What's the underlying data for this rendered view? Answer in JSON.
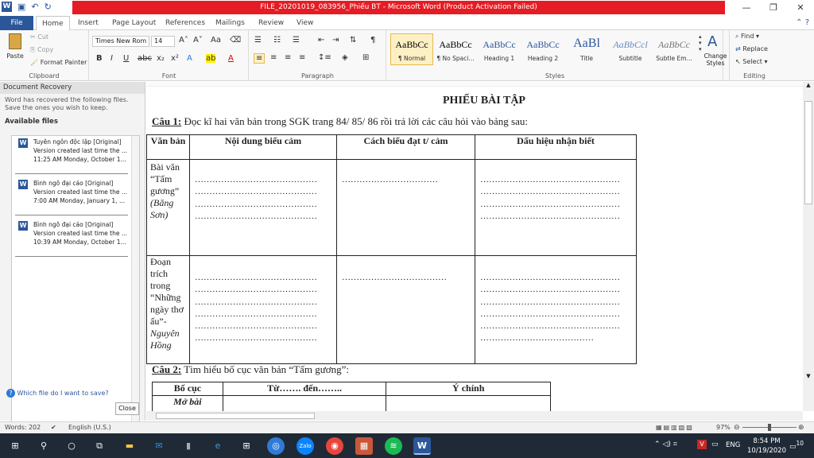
{
  "window": {
    "title": "FILE_20201019_083956_Phiếu BT - Microsoft Word (Product Activation Failed)"
  },
  "tabs": [
    "File",
    "Home",
    "Insert",
    "Page Layout",
    "References",
    "Mailings",
    "Review",
    "View"
  ],
  "clipboard": {
    "paste": "Paste",
    "cut": "Cut",
    "copy": "Copy",
    "painter": "Format Painter",
    "label": "Clipboard"
  },
  "font": {
    "name": "Times New Rom",
    "size": "14",
    "label": "Font"
  },
  "paragraph": {
    "label": "Paragraph"
  },
  "styles": {
    "label": "Styles",
    "items": [
      {
        "sample": "AaBbCc",
        "name": "¶ Normal"
      },
      {
        "sample": "AaBbCc",
        "name": "¶ No Spaci..."
      },
      {
        "sample": "AaBbCc",
        "name": "Heading 1"
      },
      {
        "sample": "AaBbCc",
        "name": "Heading 2"
      },
      {
        "sample": "AaBl",
        "name": "Title"
      },
      {
        "sample": "AaBbCcl",
        "name": "Subtitle"
      },
      {
        "sample": "AaBbCc",
        "name": "Subtle Em..."
      }
    ],
    "change": "Change Styles"
  },
  "editing": {
    "find": "Find",
    "replace": "Replace",
    "select": "Select",
    "label": "Editing"
  },
  "recovery": {
    "header": "Document Recovery",
    "desc": "Word has recovered the following files. Save the ones you wish to keep.",
    "available": "Available files",
    "files": [
      {
        "name": "Tuyên ngôn độc lập  [Original]",
        "l2": "Version created last time the ...",
        "l3": "11:25 AM Monday, October 1..."
      },
      {
        "name": "Bình ngô đại cáo  [Original]",
        "l2": "Version created last time the ...",
        "l3": "7:00 AM Monday, January 1, ..."
      },
      {
        "name": "Bình ngô đại cáo  [Original]",
        "l2": "Version created last time the ...",
        "l3": "10:39 AM Monday, October 1..."
      }
    ],
    "help": "Which file do I want to save?",
    "close": "Close"
  },
  "doc": {
    "title": "PHIẾU BÀI TẬP",
    "q1_label": "Câu 1:",
    "q1_text": " Đọc kĩ hai văn bản trong SGK trang 84/ 85/ 86 rồi trả lời các câu hỏi vào bảng sau:",
    "table1": {
      "headers": [
        "Văn bản",
        "Nội dung biểu cảm",
        "Cách biểu đạt t/ cảm",
        "Dấu hiệu nhận biết"
      ],
      "row1_title": "Bài văn “Tấm gương”",
      "row1_author": "(Băng Sơn)",
      "row2_title": "Đoạn trích trong “Những ngày thơ ấu”-",
      "row2_author": "Nguyên Hồng"
    },
    "q2_label": "Câu 2:",
    "q2_text": " Tìm hiểu bố cục văn bản “Tấm gương”:",
    "table2": {
      "headers": [
        "Bố cục",
        "Từ……. đến……..",
        "Ý  chính"
      ],
      "row1": "Mở bài"
    }
  },
  "status": {
    "words": "Words: 202",
    "lang": "English (U.S.)",
    "zoom": "97%"
  },
  "taskbar": {
    "lang": "ENG",
    "time": "8:54 PM",
    "date": "10/19/2020",
    "notif": "10"
  }
}
